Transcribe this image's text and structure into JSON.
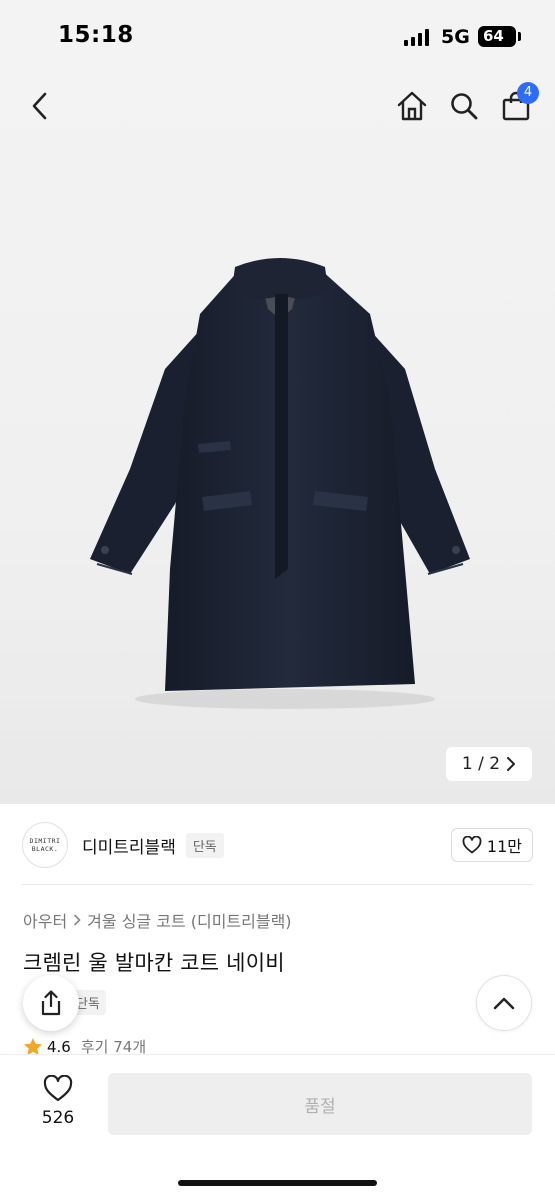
{
  "status_bar": {
    "time": "15:18",
    "network": "5G",
    "battery": "64"
  },
  "top_nav": {
    "cart_count": "4"
  },
  "gallery": {
    "pager": "1 / 2"
  },
  "brand": {
    "logo_line1": "DIMITRI",
    "logo_line2": "BLACK.",
    "name": "디미트리블랙",
    "tag": "단독",
    "likes": "11만"
  },
  "product": {
    "breadcrumb_root": "아우터",
    "breadcrumb_category": "겨울 싱글 코트 (디미트리블랙)",
    "title": "크렘린 울 발마칸 코트 네이비",
    "exclusive_tag": "단독",
    "rating": "4.6",
    "reviews": "후기 74개"
  },
  "bottom_bar": {
    "wish_count": "526",
    "soldout_label": "품절"
  },
  "colors": {
    "accent": "#2f6bff",
    "coat": "#1c2233",
    "star": "#f5a623"
  }
}
